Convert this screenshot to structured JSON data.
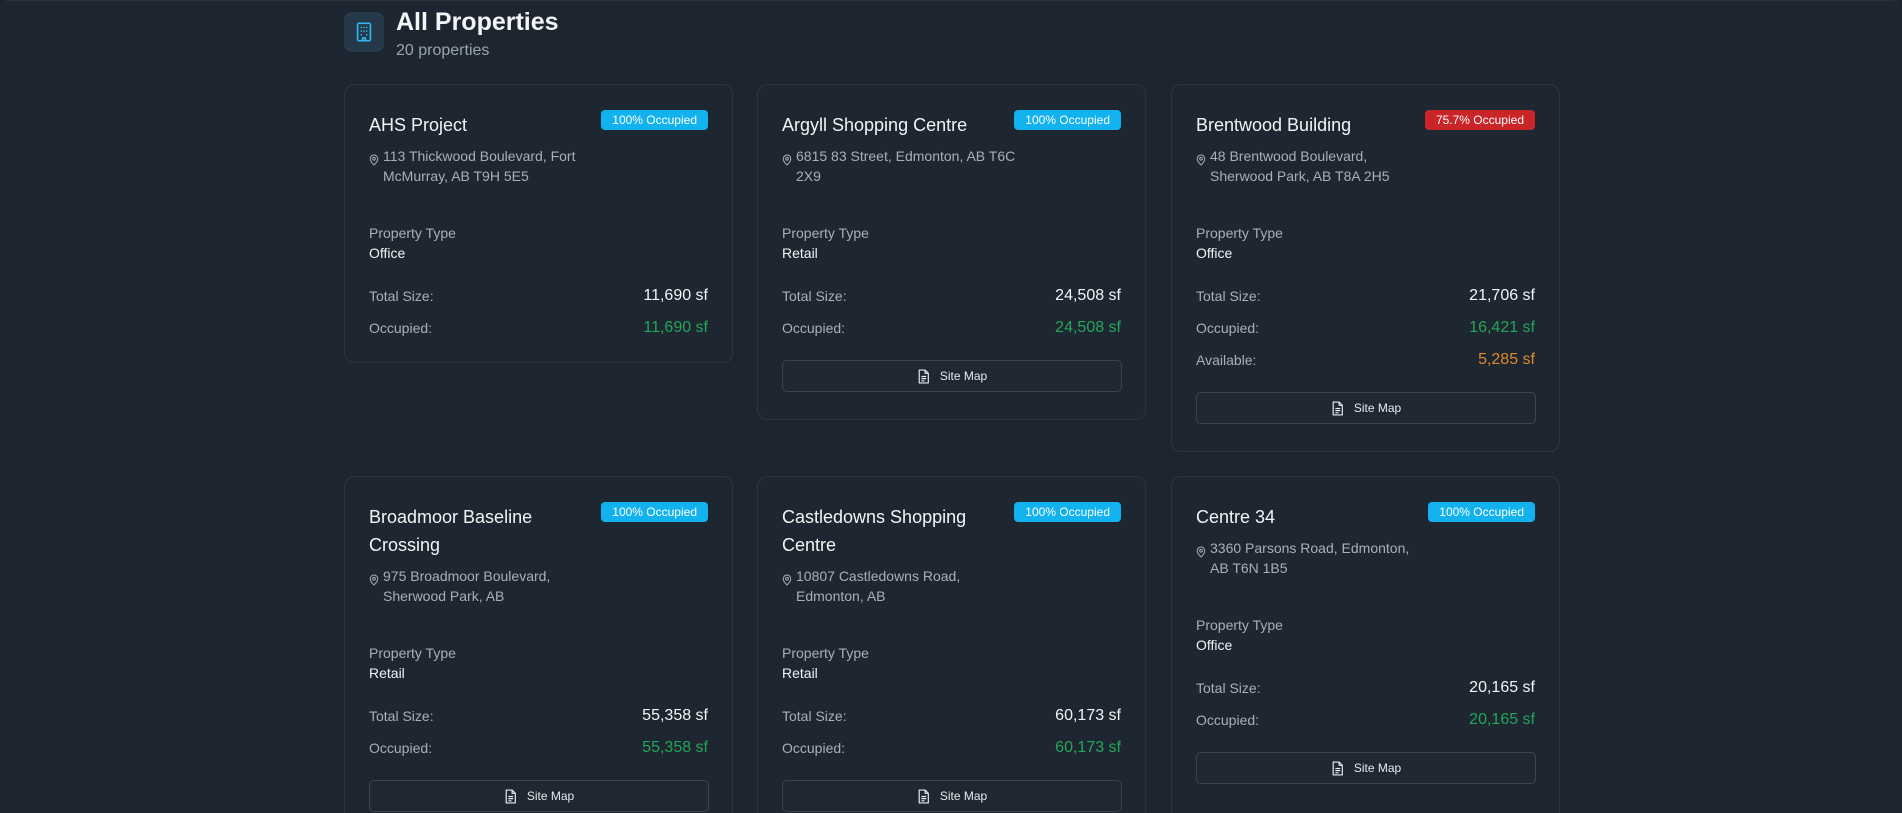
{
  "header": {
    "title": "All Properties",
    "subtitle": "20 properties",
    "icon": "building-icon"
  },
  "colors": {
    "background": "#1d2630",
    "badge_full": "#12b2ee",
    "badge_partial": "#c92428",
    "occupied": "#22a65a",
    "available": "#dd8a2a"
  },
  "labels": {
    "property_type": "Property Type",
    "total_size": "Total Size:",
    "occupied": "Occupied:",
    "available": "Available:",
    "site_map": "Site Map"
  },
  "properties": [
    {
      "name": "AHS Project",
      "badge": "100% Occupied",
      "address": "113 Thickwood Boulevard, Fort McMurray, AB T9H 5E5",
      "type": "Office",
      "total": "11,690 sf",
      "occupied": "11,690 sf"
    },
    {
      "name": "Argyll Shopping Centre",
      "badge": "100% Occupied",
      "address": "6815 83 Street, Edmonton, AB T6C 2X9",
      "type": "Retail",
      "total": "24,508 sf",
      "occupied": "24,508 sf"
    },
    {
      "name": "Brentwood Building",
      "badge": "75.7% Occupied",
      "address": "48 Brentwood Boulevard, Sherwood Park, AB T8A 2H5",
      "type": "Office",
      "total": "21,706 sf",
      "occupied": "16,421 sf",
      "available": "5,285 sf"
    },
    {
      "name": "Broadmoor Baseline Crossing",
      "badge": "100% Occupied",
      "address": "975 Broadmoor Boulevard, Sherwood Park, AB",
      "type": "Retail",
      "total": "55,358 sf",
      "occupied": "55,358 sf"
    },
    {
      "name": "Castledowns Shopping Centre",
      "badge": "100% Occupied",
      "address": "10807 Castledowns Road, Edmonton, AB",
      "type": "Retail",
      "total": "60,173 sf",
      "occupied": "60,173 sf"
    },
    {
      "name": "Centre 34",
      "badge": "100% Occupied",
      "address": "3360 Parsons Road, Edmonton, AB T6N 1B5",
      "type": "Office",
      "total": "20,165 sf",
      "occupied": "20,165 sf"
    }
  ]
}
